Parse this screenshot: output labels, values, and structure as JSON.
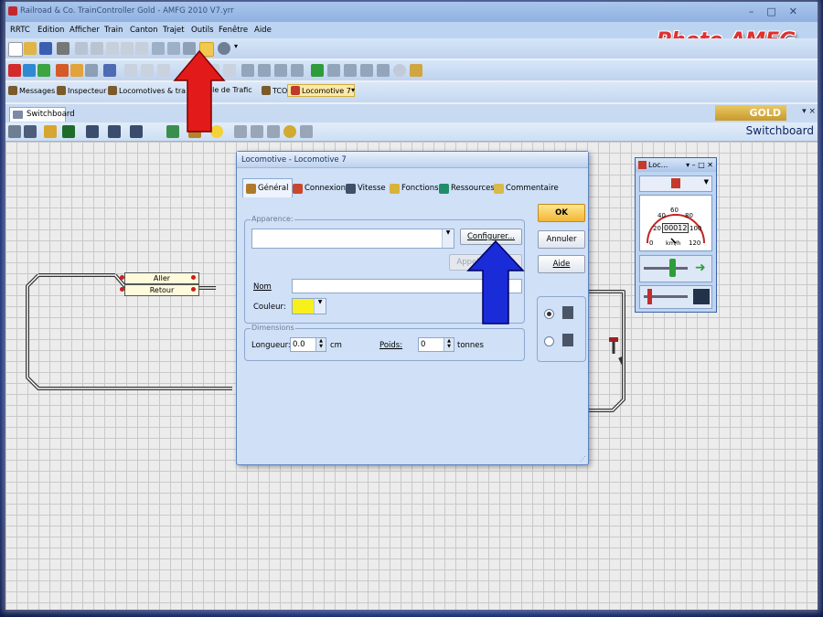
{
  "window": {
    "title": "Railroad & Co. TrainController Gold - AMFG 2010 V7.yrr"
  },
  "logo": {
    "text": "Photo AMFG"
  },
  "menu": [
    "RRTC",
    "Edition",
    "Afficher",
    "Train",
    "Canton",
    "Trajet",
    "Outils",
    "Fenêtre",
    "Aide"
  ],
  "quick_tabs": [
    "Messages",
    "Inspecteur",
    "Locomotives & tra",
    "ontrôle de Trafic",
    "TCO",
    "Locomotive 7"
  ],
  "doc_tab": {
    "label": "Switchboard"
  },
  "gold_badge": "GOLD",
  "switchboard_label": "Switchboard",
  "blocks": {
    "aller": "Aller",
    "retour": "Retour"
  },
  "dialog": {
    "title": "Locomotive - Locomotive 7",
    "tabs": [
      "Général",
      "Connexion",
      "Vitesse",
      "Fonctions",
      "Ressources",
      "Commentaire"
    ],
    "active_tab": "Général",
    "appearance_group": "Apparence:",
    "configure_button": "Configurer...",
    "animator_button": "Appel ... mator",
    "name_label": "Nom",
    "name_value": "",
    "color_label": "Couleur:",
    "color_value": "#f7f01c",
    "dimensions_group": "Dimensions",
    "length_label": "Longueur:",
    "length_value": "0.0",
    "length_unit": "cm",
    "weight_label": "Poids:",
    "weight_value": "0",
    "weight_unit": "tonnes",
    "ok_button": "OK",
    "cancel_button": "Annuler",
    "help_button": "Aide"
  },
  "loco_window": {
    "title": "Loc...",
    "speed_display": "00012",
    "speed_unit": "km/h",
    "gauge_ticks": [
      "20",
      "40",
      "60",
      "80",
      "100",
      "120",
      "0"
    ]
  },
  "colors": {
    "accent_red_arrow": "#e31a1a",
    "accent_blue_arrow": "#1a2bd8"
  }
}
